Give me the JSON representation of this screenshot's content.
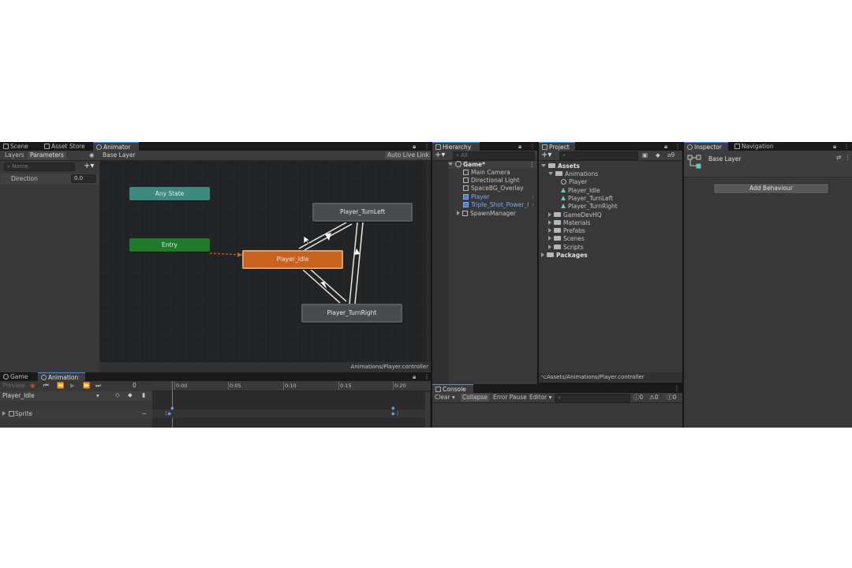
{
  "scene_panel": {
    "tabs": [
      "Scene",
      "Asset Store",
      "Animator"
    ],
    "animator": {
      "subtabs": [
        "Layers",
        "Parameters"
      ],
      "layer_breadcrumb": "Base Layer",
      "auto_live_link": "Auto Live Link",
      "search_placeholder": "Name",
      "parameter": {
        "name": "Direction",
        "value": "0.0"
      },
      "nodes": {
        "any_state": "Any State",
        "entry": "Entry",
        "idle": "Player_Idle",
        "turn_left": "Player_TurnLeft",
        "turn_right": "Player_TurnRight"
      },
      "footer_path": "Animations/Player.controller"
    }
  },
  "animation_panel": {
    "tabs": [
      "Game",
      "Animation"
    ],
    "preview_label": "Preview",
    "frame": "0",
    "clip_name": "Player_Idle",
    "property": "Sprite",
    "timeline_ticks": [
      "0:00",
      "0:05",
      "0:10",
      "0:15",
      "0:20"
    ]
  },
  "hierarchy": {
    "tab": "Hierarchy",
    "search_placeholder": "All",
    "scene": "Game*",
    "items": [
      {
        "label": "Main Camera",
        "selected": false
      },
      {
        "label": "Directional Light",
        "selected": false
      },
      {
        "label": "SpaceBG_Overlay",
        "selected": false
      },
      {
        "label": "Player",
        "selected": true
      },
      {
        "label": "Triple_Shot_Power_I",
        "selected": true
      },
      {
        "label": "SpawnManager",
        "selected": false
      }
    ]
  },
  "project": {
    "tab": "Project",
    "hidden_count": "9",
    "assets_label": "Assets",
    "animations_folder": "Animations",
    "animation_items": [
      "Player",
      "Player_Idle",
      "Player_TurnLeft",
      "Player_TurnRight"
    ],
    "folders": [
      "GameDevHQ",
      "Materials",
      "Prefabs",
      "Scenes",
      "Scripts"
    ],
    "packages_label": "Packages",
    "footer_path": "Assets/Animations/Player.controller"
  },
  "console": {
    "tab": "Console",
    "buttons": [
      "Clear",
      "Collapse",
      "Error Pause",
      "Editor"
    ],
    "counts": {
      "info": "0",
      "warnings": "0",
      "errors": "0"
    }
  },
  "inspector": {
    "tabs": [
      "Inspector",
      "Navigation"
    ],
    "title": "Base Layer",
    "add_behaviour": "Add Behaviour"
  },
  "colors": {
    "any_state": "#3d8a7e",
    "entry": "#1f7a2c",
    "default_state": "#c8621d",
    "state": "#484a4d",
    "selected_text": "#7caaf0"
  }
}
